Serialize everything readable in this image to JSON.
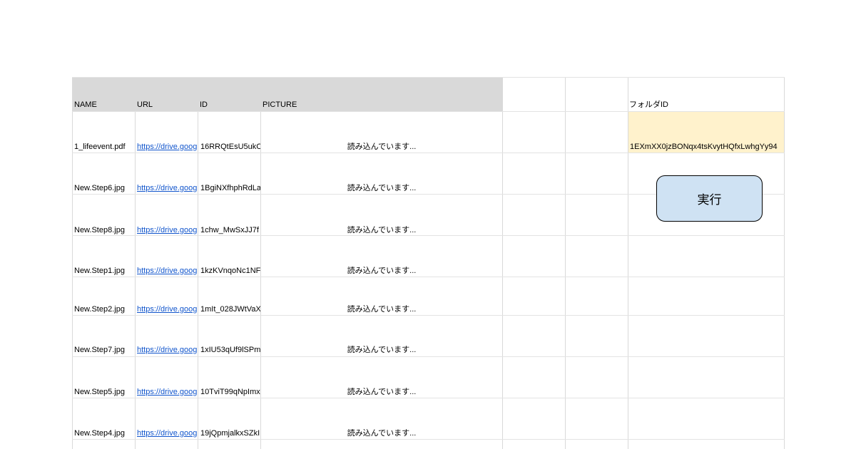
{
  "headers": {
    "name": "NAME",
    "url": "URL",
    "id": "ID",
    "picture": "PICTURE",
    "folder_id": "フォルダID"
  },
  "folder_id_value": "1EXmXX0jzBONqx4tsKvytHQfxLwhgYy94",
  "run_button": "実行",
  "rows": [
    {
      "name": "1_lifeevent.pdf",
      "url": "https://drive.goog",
      "id": "16RRQtEsU5ukC",
      "picture": "読み込んでいます..."
    },
    {
      "name": "New.Step6.jpg",
      "url": "https://drive.goog",
      "id": "1BgiNXfhphRdLa",
      "picture": "読み込んでいます..."
    },
    {
      "name": "New.Step8.jpg",
      "url": "https://drive.goog",
      "id": "1chw_MwSxJJ7f",
      "picture": "読み込んでいます..."
    },
    {
      "name": "New.Step1.jpg",
      "url": "https://drive.goog",
      "id": "1kzKVnqoNc1NF",
      "picture": "読み込んでいます..."
    },
    {
      "name": "New.Step2.jpg",
      "url": "https://drive.goog",
      "id": "1mIt_028JWtVaX",
      "picture": "読み込んでいます..."
    },
    {
      "name": "New.Step7.jpg",
      "url": "https://drive.goog",
      "id": "1xIU53qUf9lSPm",
      "picture": "読み込んでいます..."
    },
    {
      "name": "New.Step5.jpg",
      "url": "https://drive.goog",
      "id": "10TviT99qNpImx",
      "picture": "読み込んでいます..."
    },
    {
      "name": "New.Step4.jpg",
      "url": "https://drive.goog",
      "id": "19jQpmjalkxSZkI",
      "picture": "読み込んでいます..."
    }
  ]
}
